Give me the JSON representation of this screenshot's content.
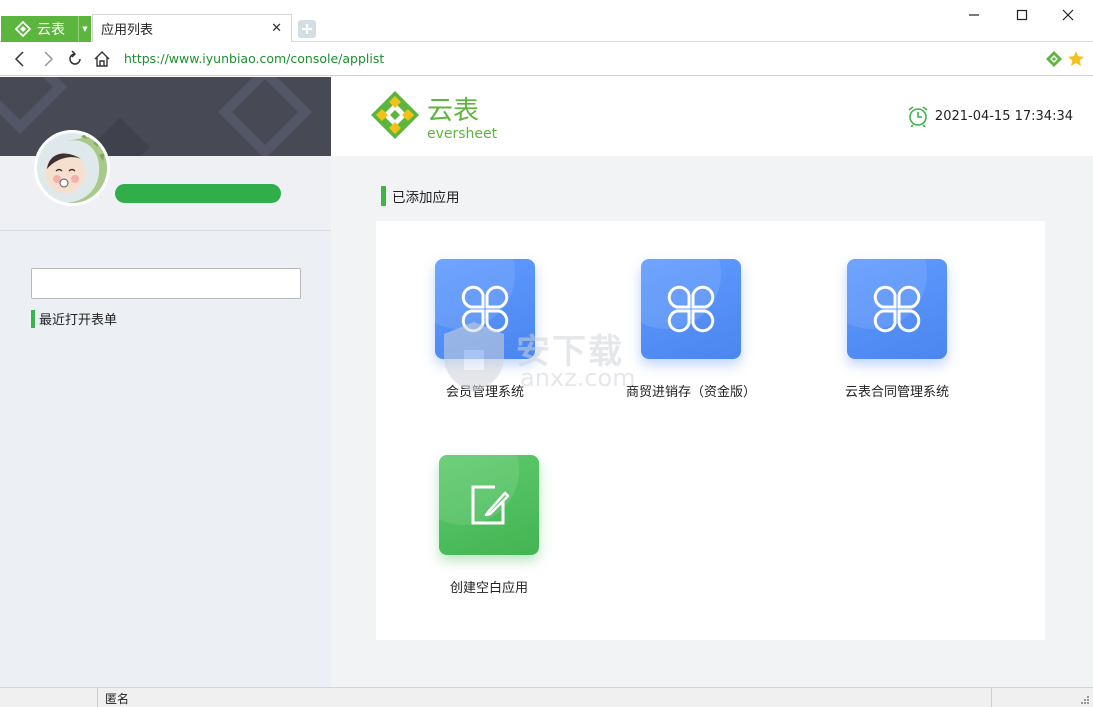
{
  "browser": {
    "app_name": "云表",
    "tab_title": "应用列表",
    "url": "https://www.iyunbiao.com/console/applist"
  },
  "header": {
    "brand_cn": "云表",
    "brand_en": "eversheet",
    "datetime": "2021-04-15 17:34:34"
  },
  "sidebar": {
    "search_value": "",
    "recent_label": "最近打开表单"
  },
  "main": {
    "section_title": "已添加应用",
    "apps": [
      {
        "name": "会员管理系统",
        "icon": "clover-icon"
      },
      {
        "name": "商贸进销存（资金版）",
        "icon": "clover-icon"
      },
      {
        "name": "云表合同管理系统",
        "icon": "clover-icon"
      },
      {
        "name": "创建空白应用",
        "icon": "edit-icon"
      }
    ]
  },
  "watermark": {
    "text": "安下载",
    "sub": "anxz.com"
  },
  "statusbar": {
    "user": "匿名"
  },
  "colors": {
    "accent_green": "#5cb53d",
    "tile_blue": "#4b86f0",
    "tile_green": "#43b453",
    "sidebar_dark": "#474a55"
  }
}
